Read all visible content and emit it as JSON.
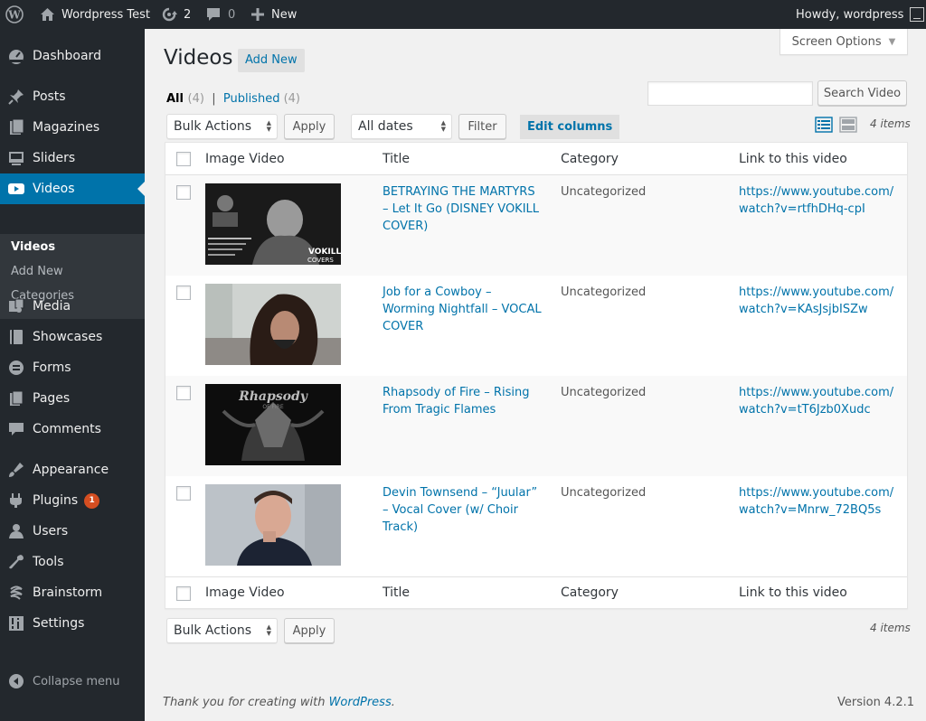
{
  "adminbar": {
    "site_name": "Wordpress Test",
    "updates_count": "2",
    "comments_count": "0",
    "new_label": "New",
    "howdy": "Howdy, wordpress"
  },
  "sidebar": {
    "items": [
      {
        "label": "Dashboard",
        "icon": "dashboard-icon"
      },
      {
        "label": "Posts",
        "icon": "pin-icon"
      },
      {
        "label": "Magazines",
        "icon": "magazine-icon"
      },
      {
        "label": "Sliders",
        "icon": "slides-icon"
      },
      {
        "label": "Videos",
        "icon": "video-icon"
      },
      {
        "label": "Media",
        "icon": "media-icon"
      },
      {
        "label": "Showcases",
        "icon": "book-icon"
      },
      {
        "label": "Forms",
        "icon": "forms-icon"
      },
      {
        "label": "Pages",
        "icon": "pages-icon"
      },
      {
        "label": "Comments",
        "icon": "comment-icon"
      },
      {
        "label": "Appearance",
        "icon": "brush-icon"
      },
      {
        "label": "Plugins",
        "icon": "plugin-icon",
        "badge": "1"
      },
      {
        "label": "Users",
        "icon": "users-icon"
      },
      {
        "label": "Tools",
        "icon": "wrench-icon"
      },
      {
        "label": "Brainstorm",
        "icon": "brainstorm-icon"
      },
      {
        "label": "Settings",
        "icon": "settings-icon"
      }
    ],
    "submenu": [
      "Videos",
      "Add New",
      "Categories"
    ],
    "collapse_label": "Collapse menu"
  },
  "page": {
    "title": "Videos",
    "add_new": "Add New",
    "screen_options": "Screen Options",
    "filter_all": "All",
    "filter_all_count": "(4)",
    "filter_sep": "|",
    "filter_published": "Published",
    "filter_published_count": "(4)",
    "search_value": "",
    "search_button": "Search Video",
    "bulk_actions": "Bulk Actions",
    "apply": "Apply",
    "all_dates": "All dates",
    "filter_button": "Filter",
    "edit_columns": "Edit columns",
    "items_count": "4 items"
  },
  "table": {
    "columns": [
      "Image Video",
      "Title",
      "Category",
      "Link to this video"
    ],
    "rows": [
      {
        "title": "BETRAYING THE MARTYRS – Let It Go (DISNEY VOKILL COVER)",
        "category": "Uncategorized",
        "link": "https://www.youtube.com/watch?v=rtfhDHq-cpI",
        "thumb_text": "VOKILL",
        "thumb_sub": "COVERS"
      },
      {
        "title": "Job for a Cowboy – Worming Nightfall – VOCAL COVER",
        "category": "Uncategorized",
        "link": "https://www.youtube.com/watch?v=KAsJsjbISZw"
      },
      {
        "title": "Rhapsody of Fire – Rising From Tragic Flames",
        "category": "Uncategorized",
        "link": "https://www.youtube.com/watch?v=tT6Jzb0Xudc",
        "thumb_text": "Rhapsody",
        "thumb_sub": "OF FIRE"
      },
      {
        "title": "Devin Townsend – “Juular” – Vocal Cover (w/ Choir Track)",
        "category": "Uncategorized",
        "link": "https://www.youtube.com/watch?v=Mnrw_72BQ5s"
      }
    ]
  },
  "footer": {
    "thanks_prefix": "Thank you for creating with ",
    "thanks_link": "WordPress",
    "thanks_suffix": ".",
    "version": "Version 4.2.1"
  }
}
